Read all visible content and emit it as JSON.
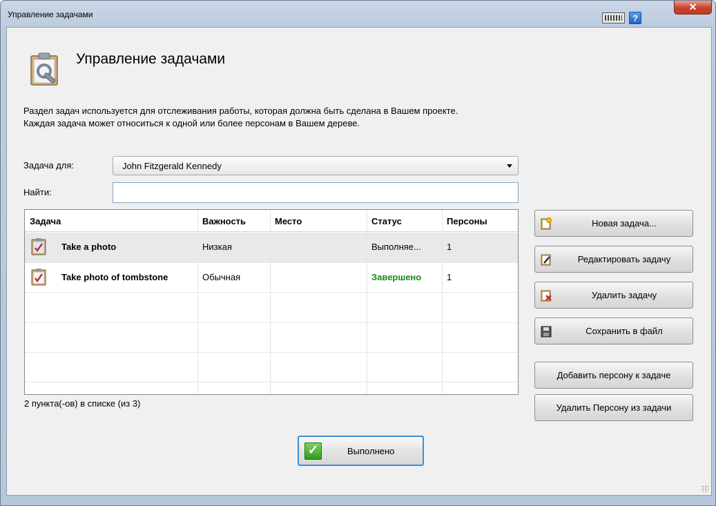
{
  "window": {
    "title": "Управление задачами"
  },
  "header": {
    "heading": "Управление задачами",
    "description_line1": "Раздел задач используется для отслеживания работы, которая должна быть сделана в Вашем проекте.",
    "description_line2": "Каждая задача может относиться к одной или более персонам в Вашем дереве."
  },
  "filters": {
    "task_for_label": "Задача для:",
    "task_for_value": "John Fitzgerald Kennedy",
    "find_label": "Найти:",
    "find_value": ""
  },
  "grid": {
    "columns": [
      "Задача",
      "Важность",
      "Место",
      "Статус",
      "Персоны"
    ],
    "rows": [
      {
        "task": "Take a photo",
        "priority": "Низкая",
        "place": "",
        "status": "Выполняе...",
        "persons": "1"
      },
      {
        "task": "Take photo of tombstone",
        "priority": "Обычная",
        "place": "",
        "status": "Завершено",
        "persons": "1"
      }
    ],
    "count_text": "2 пункта(-ов) в списке (из 3)"
  },
  "buttons": {
    "new_task": "Новая задача...",
    "edit_task": "Редактировать задачу",
    "delete_task": "Удалить задачу",
    "save_to_file": "Сохранить в файл",
    "add_person": "Добавить персону к задаче",
    "remove_person": "Удалить Персону из задачи",
    "done": "Выполнено"
  },
  "colors": {
    "status_done": "#1a8a1a",
    "focus_border": "#3c8ed4"
  },
  "icons": {
    "keyboard": "keyboard-icon",
    "help": "help-icon",
    "close": "close-icon",
    "header": "clipboard-wrench-icon",
    "task": "clipboard-check-icon"
  }
}
